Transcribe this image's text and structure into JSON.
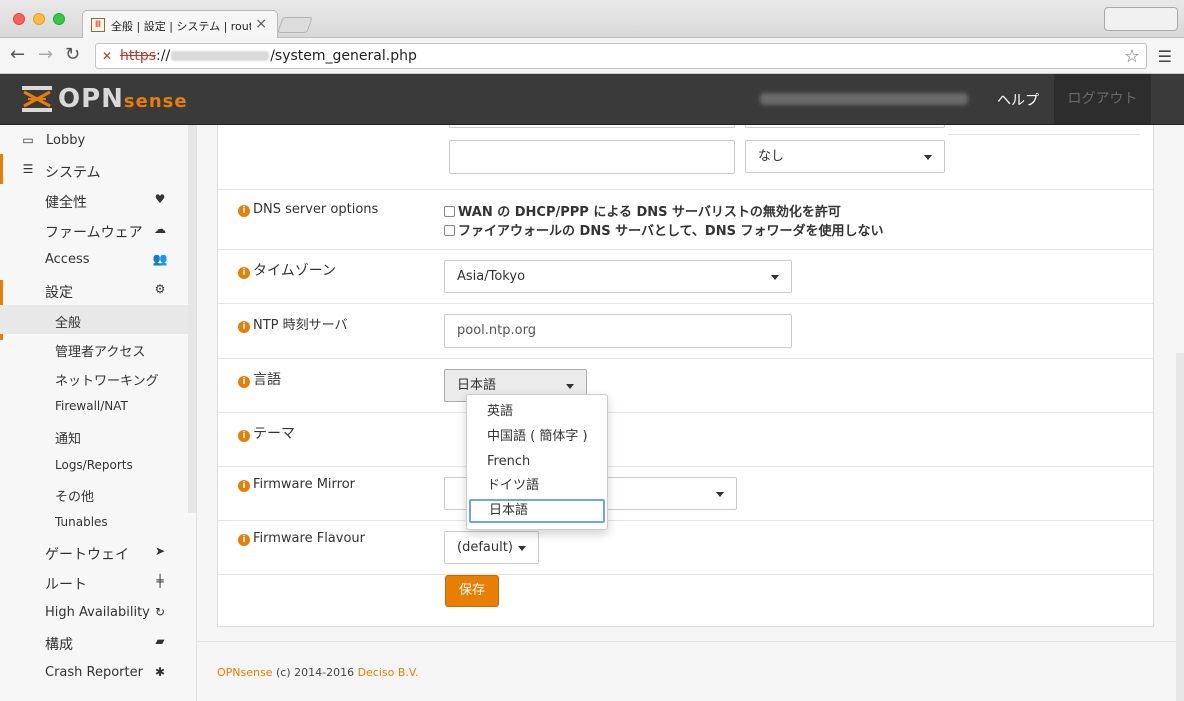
{
  "browser": {
    "tab_title": "全般 | 設定 | システム | router",
    "tab_close": "×",
    "url_scheme": "https",
    "url_sep": "://",
    "url_path": "/system_general.php"
  },
  "header": {
    "logo_opn": "OPN",
    "logo_sense": "sense",
    "help": "ヘルプ",
    "logout": "ログアウト"
  },
  "sidebar": {
    "items": [
      {
        "label": "Lobby",
        "icon": "laptop-icon"
      },
      {
        "label": "システム",
        "icon": "server-icon"
      },
      {
        "label": "健全性",
        "icon": "heartbeat-icon"
      },
      {
        "label": "ファームウェア",
        "icon": "cloud-download-icon"
      },
      {
        "label": "Access",
        "icon": "users-icon"
      },
      {
        "label": "設定",
        "icon": "cogs-icon"
      },
      {
        "label": "全般"
      },
      {
        "label": "管理者アクセス"
      },
      {
        "label": "ネットワーキング"
      },
      {
        "label": "Firewall/NAT"
      },
      {
        "label": "通知"
      },
      {
        "label": "Logs/Reports"
      },
      {
        "label": "その他"
      },
      {
        "label": "Tunables"
      },
      {
        "label": "ゲートウェイ",
        "icon": "location-arrow-icon"
      },
      {
        "label": "ルート",
        "icon": "map-signs-icon"
      },
      {
        "label": "High Availability",
        "icon": "refresh-icon"
      },
      {
        "label": "構成",
        "icon": "book-icon"
      },
      {
        "label": "Crash Reporter",
        "icon": "bug-icon"
      }
    ]
  },
  "form": {
    "dns_gateway_select": "なし",
    "dns_options_label": "DNS server options",
    "dns_opt1": "WAN の DHCP/PPP による DNS サーバリストの無効化を許可",
    "dns_opt2": "ファイアウォールの DNS サーバとして、DNS フォワーダを使用しない",
    "timezone_label": "タイムゾーン",
    "timezone_value": "Asia/Tokyo",
    "ntp_label": "NTP 時刻サーバ",
    "ntp_value": "pool.ntp.org",
    "language_label": "言語",
    "language_value": "日本語",
    "theme_label": "テーマ",
    "firmware_mirror_label": "Firmware Mirror",
    "firmware_flavour_label": "Firmware Flavour",
    "firmware_flavour_value": "(default)",
    "save": "保存"
  },
  "language_options": [
    "英語",
    "中国語 ( 簡体字 )",
    "French",
    "ドイツ語",
    "日本語"
  ],
  "footer": {
    "brand": "OPNsense",
    "copyright": " (c) 2014-2016 ",
    "company": "Deciso B.V."
  },
  "colors": {
    "accent": "#e87e04",
    "header_bg": "#3a3a3a"
  }
}
